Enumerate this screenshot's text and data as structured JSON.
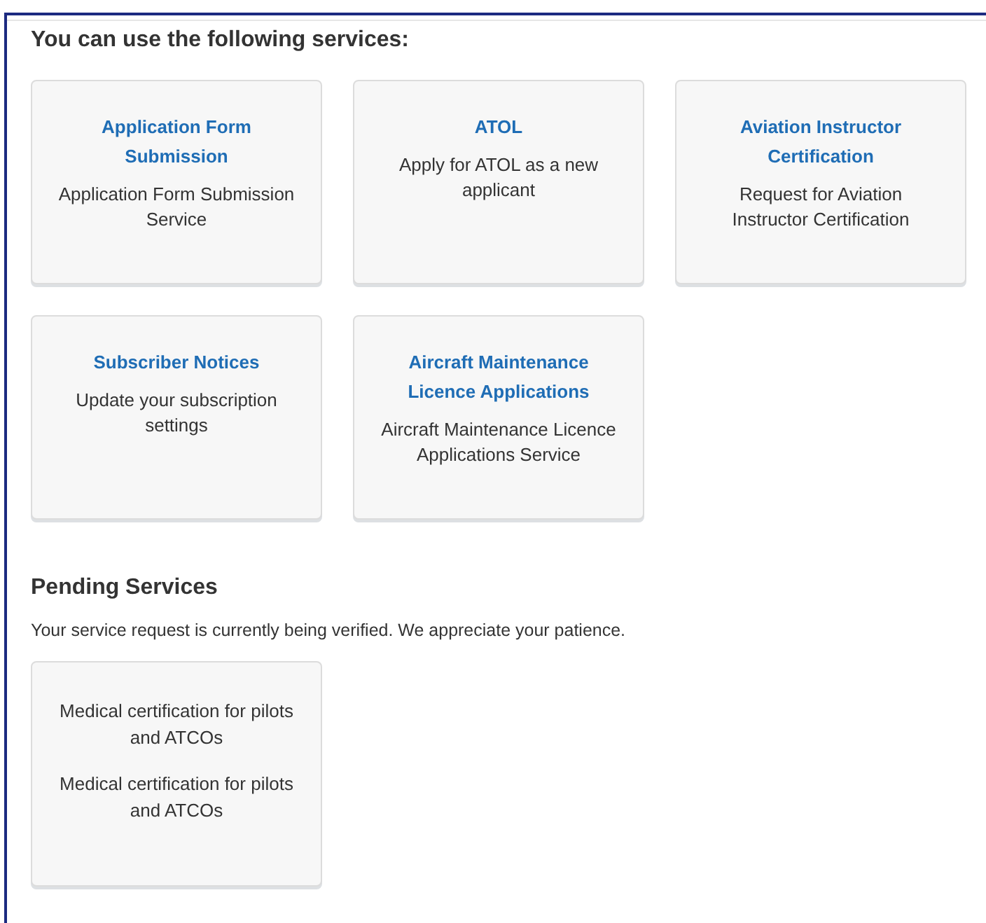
{
  "services": {
    "heading": "You can use the following services:",
    "cards": [
      {
        "title": "Application Form Submission",
        "description": "Application Form Submission Service"
      },
      {
        "title": "ATOL",
        "description": "Apply for ATOL as a new applicant"
      },
      {
        "title": "Aviation Instructor Certification",
        "description": "Request for Aviation Instructor Certification"
      },
      {
        "title": "Subscriber Notices",
        "description": "Update your subscription settings"
      },
      {
        "title": "Aircraft Maintenance Licence Applications",
        "description": "Aircraft Maintenance Licence Applications Service"
      }
    ]
  },
  "pending": {
    "heading": "Pending Services",
    "message": "Your service request is currently being verified. We appreciate your patience.",
    "cards": [
      {
        "lines": [
          "Medical certification for pilots and ATCOs",
          "Medical certification for pilots and ATCOs"
        ]
      }
    ]
  }
}
